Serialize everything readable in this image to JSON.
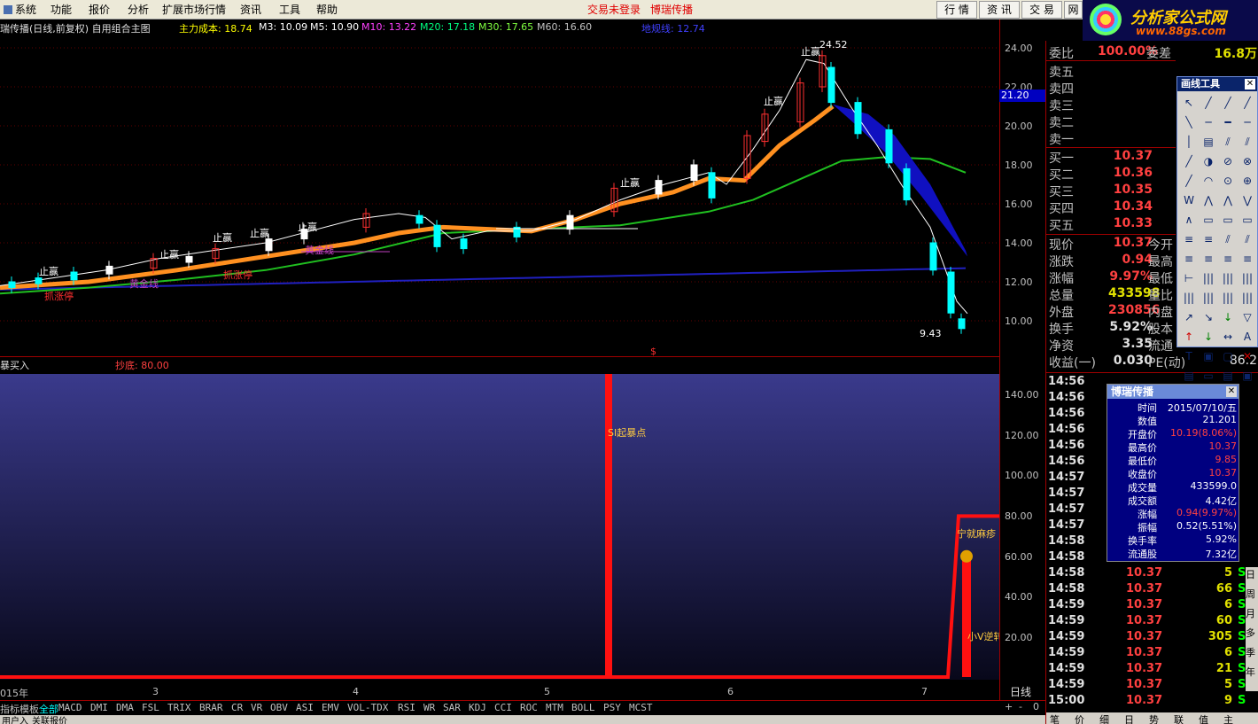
{
  "menu": {
    "items": [
      "系统",
      "功能",
      "报价",
      "分析",
      "扩展市场行情",
      "资讯",
      "工具",
      "帮助"
    ],
    "login_warning": "交易未登录",
    "brand": "博瑞传播",
    "right_buttons": [
      "行 情",
      "资 讯",
      "交 易",
      "网"
    ]
  },
  "logo": {
    "line1": "分析家公式网",
    "line2": "www.88gs.com"
  },
  "chart_header": {
    "title": "瑞传播(日线,前复权) 自用组合主图",
    "cost_label": "主力成本: 18.74",
    "m3": "M3: 10.09",
    "m5": "M5: 10.90",
    "m10": "M10: 13.22",
    "m20": "M20: 17.18",
    "m30": "M30: 17.65",
    "m60": "M60: 16.60",
    "low_line": "地规线: 12.74"
  },
  "price_axis": [
    "24.00",
    "22.00",
    "20.00",
    "18.00",
    "16.00",
    "14.00",
    "12.00",
    "10.00"
  ],
  "current_price_marker": "21.20",
  "price_annotations": {
    "high": "24.52",
    "low": "9.43",
    "stop1": "止赢",
    "zhangting": "抓涨停",
    "huangjin": "黄金线",
    "dollar": "$"
  },
  "indicator_header": {
    "name": "暴买入",
    "value": "抄底: 80.00"
  },
  "indicator_axis": [
    "140.00",
    "120.00",
    "100.00",
    "80.00",
    "60.00",
    "40.00",
    "20.00"
  ],
  "indicator_annotations": {
    "si": "SI起暴点",
    "small_v": "小V逆转",
    "top": "宁就麻疹"
  },
  "date_axis": [
    "015年",
    "3",
    "4",
    "5",
    "6",
    "7"
  ],
  "period": "日线",
  "tabs": [
    "指标",
    "模板",
    "全部",
    "MACD",
    "DMI",
    "DMA",
    "FSL",
    "TRIX",
    "BRAR",
    "CR",
    "VR",
    "OBV",
    "ASI",
    "EMV",
    "VOL-TDX",
    "RSI",
    "WR",
    "SAR",
    "KDJ",
    "CCI",
    "ROC",
    "MTM",
    "BOLL",
    "PSY",
    "MCST"
  ],
  "status_bar": [
    "用户入",
    "关联报价"
  ],
  "quotes": {
    "weibi": {
      "label": "委比",
      "value": "100.00%",
      "label2": "委差",
      "value2": "16.8万"
    },
    "sell": [
      {
        "label": "卖五"
      },
      {
        "label": "卖四"
      },
      {
        "label": "卖三"
      },
      {
        "label": "卖二"
      },
      {
        "label": "卖一"
      }
    ],
    "buy": [
      {
        "label": "买一",
        "price": "10.37"
      },
      {
        "label": "买二",
        "price": "10.36"
      },
      {
        "label": "买三",
        "price": "10.35"
      },
      {
        "label": "买四",
        "price": "10.34"
      },
      {
        "label": "买五",
        "price": "10.33"
      }
    ],
    "stats": [
      {
        "label": "现价",
        "value": "10.37",
        "label2": "今开"
      },
      {
        "label": "涨跌",
        "value": "0.94",
        "label2": "最高"
      },
      {
        "label": "涨幅",
        "value": "9.97%",
        "label2": "最低"
      },
      {
        "label": "总量",
        "value": "433598",
        "label2": "量比"
      },
      {
        "label": "外盘",
        "value": "230856",
        "label2": "内盘"
      },
      {
        "label": "换手",
        "value": "5.92%",
        "label2": "股本"
      },
      {
        "label": "净资",
        "value": "3.35",
        "label2": "流通"
      },
      {
        "label": "收益(一)",
        "value": "0.030",
        "label2": "PE(动)",
        "value2": "86.2"
      }
    ]
  },
  "ticks": [
    {
      "time": "14:56"
    },
    {
      "time": "14:56"
    },
    {
      "time": "14:56"
    },
    {
      "time": "14:56"
    },
    {
      "time": "14:56"
    },
    {
      "time": "14:56"
    },
    {
      "time": "14:57"
    },
    {
      "time": "14:57"
    },
    {
      "time": "14:57"
    },
    {
      "time": "14:57"
    },
    {
      "time": "14:58"
    },
    {
      "time": "14:58"
    },
    {
      "time": "14:58",
      "price": "10.37",
      "vol": "5",
      "side": "S"
    },
    {
      "time": "14:58",
      "price": "10.37",
      "vol": "66",
      "side": "S"
    },
    {
      "time": "14:59",
      "price": "10.37",
      "vol": "6",
      "side": "S"
    },
    {
      "time": "14:59",
      "price": "10.37",
      "vol": "60",
      "side": "S"
    },
    {
      "time": "14:59",
      "price": "10.37",
      "vol": "305",
      "side": "S"
    },
    {
      "time": "14:59",
      "price": "10.37",
      "vol": "6",
      "side": "S"
    },
    {
      "time": "14:59",
      "price": "10.37",
      "vol": "21",
      "side": "S"
    },
    {
      "time": "14:59",
      "price": "10.37",
      "vol": "5",
      "side": "S"
    },
    {
      "time": "15:00",
      "price": "10.37",
      "vol": "9",
      "side": "S"
    }
  ],
  "draw_tools": {
    "title": "画线工具"
  },
  "info_popup": {
    "title": "博瑞传播",
    "rows": [
      {
        "label": "时间",
        "value": "2015/07/10/五"
      },
      {
        "label": "数值",
        "value": "21.201"
      },
      {
        "label": "开盘价",
        "value": "10.19(8.06%)",
        "color": "#ff4040"
      },
      {
        "label": "最高价",
        "value": "10.37",
        "color": "#ff4040"
      },
      {
        "label": "最低价",
        "value": "9.85",
        "color": "#ff4040"
      },
      {
        "label": "收盘价",
        "value": "10.37",
        "color": "#ff4040"
      },
      {
        "label": "成交量",
        "value": "433599.0"
      },
      {
        "label": "成交额",
        "value": "4.42亿"
      },
      {
        "label": "涨幅",
        "value": "0.94(9.97%)",
        "color": "#ff4040"
      },
      {
        "label": "振幅",
        "value": "0.52(5.51%)"
      },
      {
        "label": "换手率",
        "value": "5.92%"
      },
      {
        "label": "流通股",
        "value": "7.32亿"
      }
    ]
  },
  "side_buttons": [
    "日",
    "周",
    "月",
    "多",
    "季",
    "年"
  ],
  "bottom_right_tabs": [
    "笔",
    "价",
    "细",
    "日",
    "势",
    "联",
    "值",
    "主"
  ]
}
